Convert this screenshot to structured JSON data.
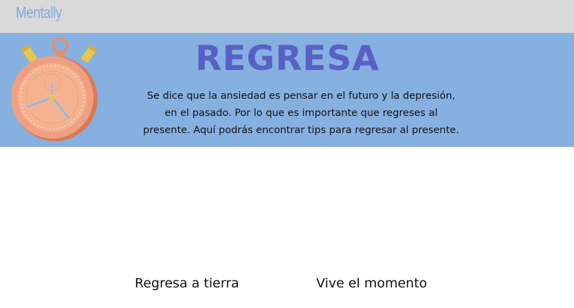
{
  "header": {
    "brand": "Mentally"
  },
  "hero": {
    "title": "REGRESA",
    "description_lines": [
      "Se dice que la ansiedad es pensar en el futuro y la depresión,",
      "en el pasado. Por lo que es importante que regreses al",
      "presente. Aquí podrás encontrar tips para regresar al presente."
    ],
    "illustration": "stopwatch-icon"
  },
  "links": [
    {
      "label": "Regresa a tierra"
    },
    {
      "label": "Vive el momento"
    }
  ],
  "colors": {
    "topbar": "#d9d9d9",
    "brand": "#7fa9dc",
    "hero_background": "#86b0e0",
    "hero_title": "#5a5fc7",
    "stopwatch_body": "#f0a080",
    "stopwatch_buttons": "#e8c84a"
  }
}
